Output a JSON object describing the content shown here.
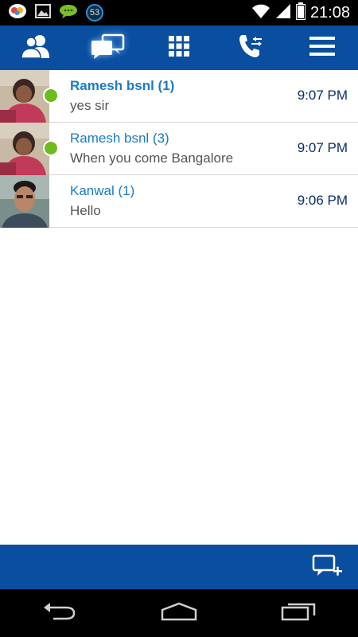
{
  "status_bar": {
    "notification_count": "53",
    "time": "21:08"
  },
  "top_nav": {
    "items": [
      {
        "icon": "contacts-icon",
        "active": false
      },
      {
        "icon": "chats-icon",
        "active": true
      },
      {
        "icon": "dialpad-icon",
        "active": false
      },
      {
        "icon": "call-log-icon",
        "active": false
      },
      {
        "icon": "menu-icon",
        "active": false
      }
    ]
  },
  "conversations": [
    {
      "name": "Ramesh bsnl (1)",
      "message": "yes sir",
      "time": "9:07 PM",
      "online": true,
      "unread_bold": true
    },
    {
      "name": "Ramesh bsnl (3)",
      "message": "When you come Bangalore",
      "time": "9:07 PM",
      "online": true,
      "unread_bold": false
    },
    {
      "name": "Kanwal (1)",
      "message": "Hello",
      "time": "9:06 PM",
      "online": false,
      "unread_bold": false
    }
  ],
  "colors": {
    "bar_blue": "#0a4ea0",
    "name_blue": "#1a7ac8",
    "time_navy": "#0a2f6a",
    "online_green": "#6dbb1e"
  }
}
